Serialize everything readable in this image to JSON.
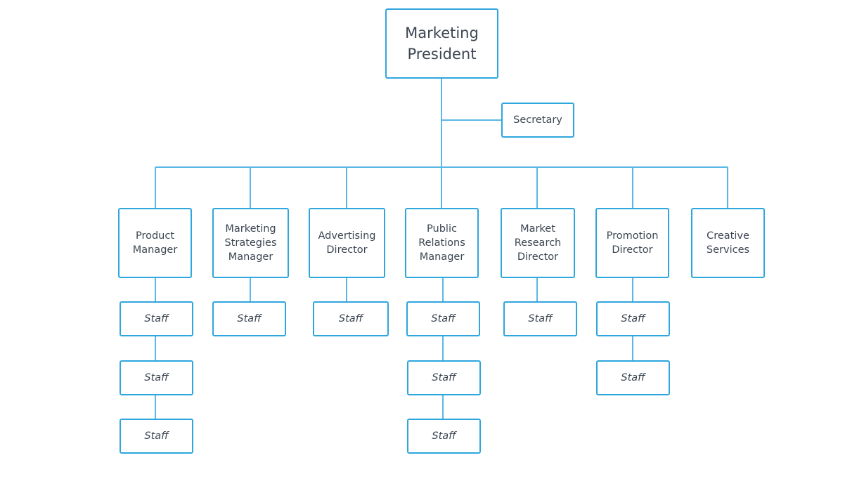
{
  "colors": {
    "border": "#2ea6de",
    "connector": "#5ab8e6",
    "text": "#3c4652"
  },
  "president": "Marketing\nPresident",
  "secretary": "Secretary",
  "departments": [
    {
      "title": "Product\nManager",
      "staff": [
        "Staff",
        "Staff",
        "Staff"
      ]
    },
    {
      "title": "Marketing\nStrategies\nManager",
      "staff": [
        "Staff"
      ]
    },
    {
      "title": "Advertising\nDirector",
      "staff": [
        "Staff"
      ]
    },
    {
      "title": "Public\nRelations\nManager",
      "staff": [
        "Staff",
        "Staff",
        "Staff"
      ]
    },
    {
      "title": "Market\nResearch\nDirector",
      "staff": [
        "Staff"
      ]
    },
    {
      "title": "Promotion\nDirector",
      "staff": [
        "Staff",
        "Staff"
      ]
    },
    {
      "title": "Creative\nServices",
      "staff": []
    }
  ]
}
